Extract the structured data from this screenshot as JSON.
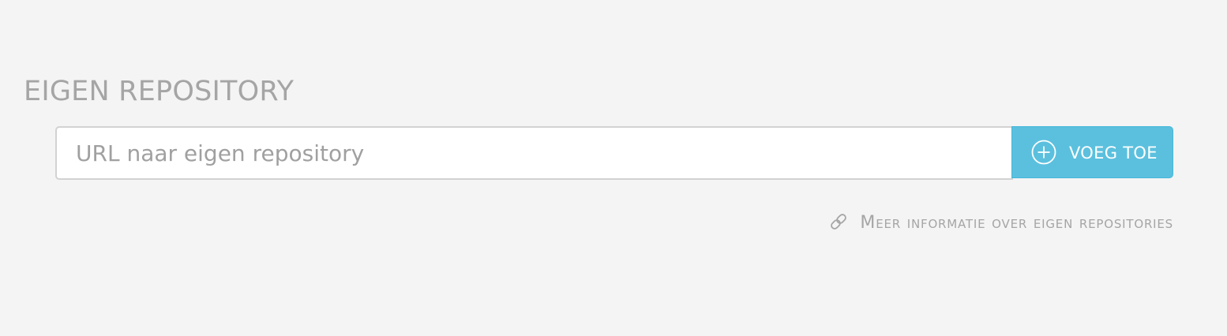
{
  "section": {
    "title": "EIGEN REPOSITORY"
  },
  "repo_form": {
    "input_value": "",
    "input_placeholder": "URL naar eigen repository",
    "add_button_label": "VOEG TOE",
    "add_button_icon": "plus-circle-icon"
  },
  "info_link": {
    "label": "Meer informatie over eigen repositories",
    "icon": "link-icon"
  },
  "colors": {
    "background": "#f4f4f4",
    "accent": "#5bc0de",
    "muted_text": "#a5a5a5"
  }
}
